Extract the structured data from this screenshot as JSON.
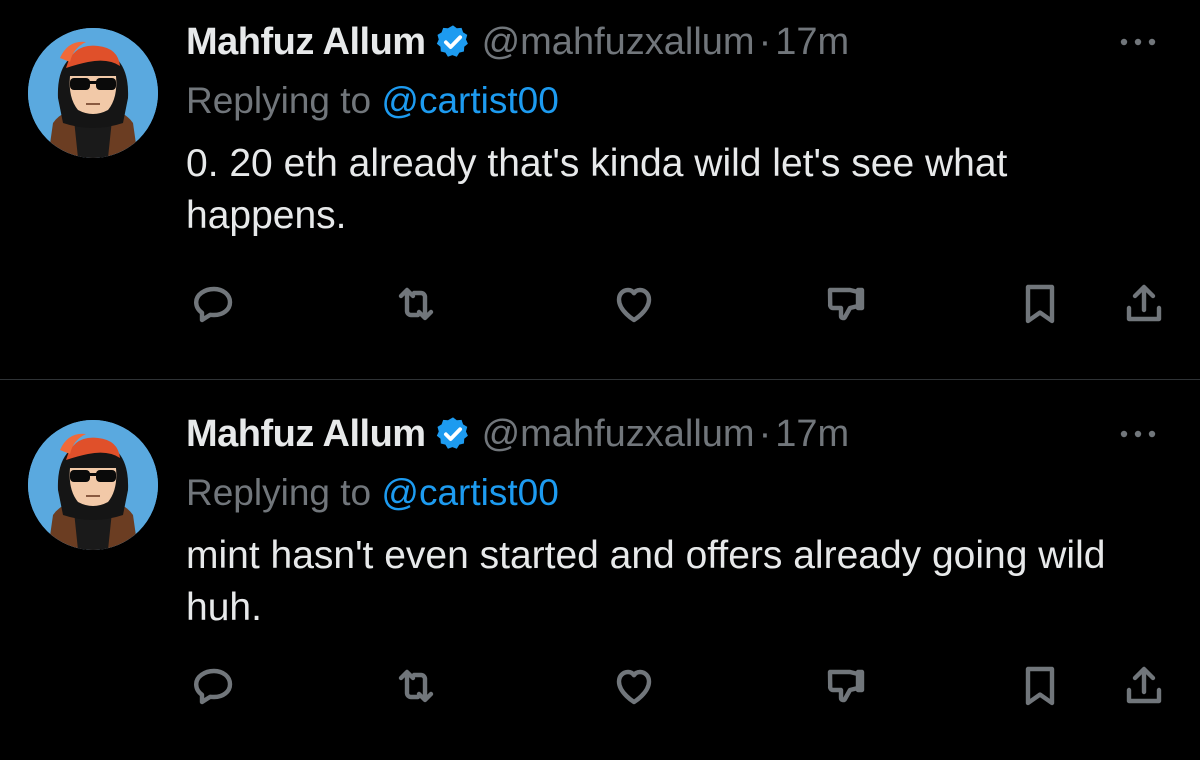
{
  "tweets": [
    {
      "author_name": "Mahfuz Allum",
      "handle": "@mahfuzxallum",
      "separator": "·",
      "time": "17m",
      "replying_prefix": "Replying to ",
      "replying_to": "@cartist00",
      "text": "0. 20 eth already that's kinda wild let's see what happens."
    },
    {
      "author_name": "Mahfuz Allum",
      "handle": "@mahfuzxallum",
      "separator": "·",
      "time": "17m",
      "replying_prefix": "Replying to ",
      "replying_to": "@cartist00",
      "text": "mint hasn't even started and offers already going wild huh."
    }
  ],
  "icons": {
    "verified": "verified-badge-icon",
    "more": "more-horizontal-icon",
    "reply": "reply-icon",
    "retweet": "retweet-icon",
    "like": "like-icon",
    "dislike": "downvote-icon",
    "bookmark": "bookmark-icon",
    "share": "share-icon"
  },
  "colors": {
    "background": "#000000",
    "text": "#e7e9ea",
    "muted": "#71767b",
    "accent": "#1d9bf0",
    "avatar_bg": "#5aa9df"
  }
}
